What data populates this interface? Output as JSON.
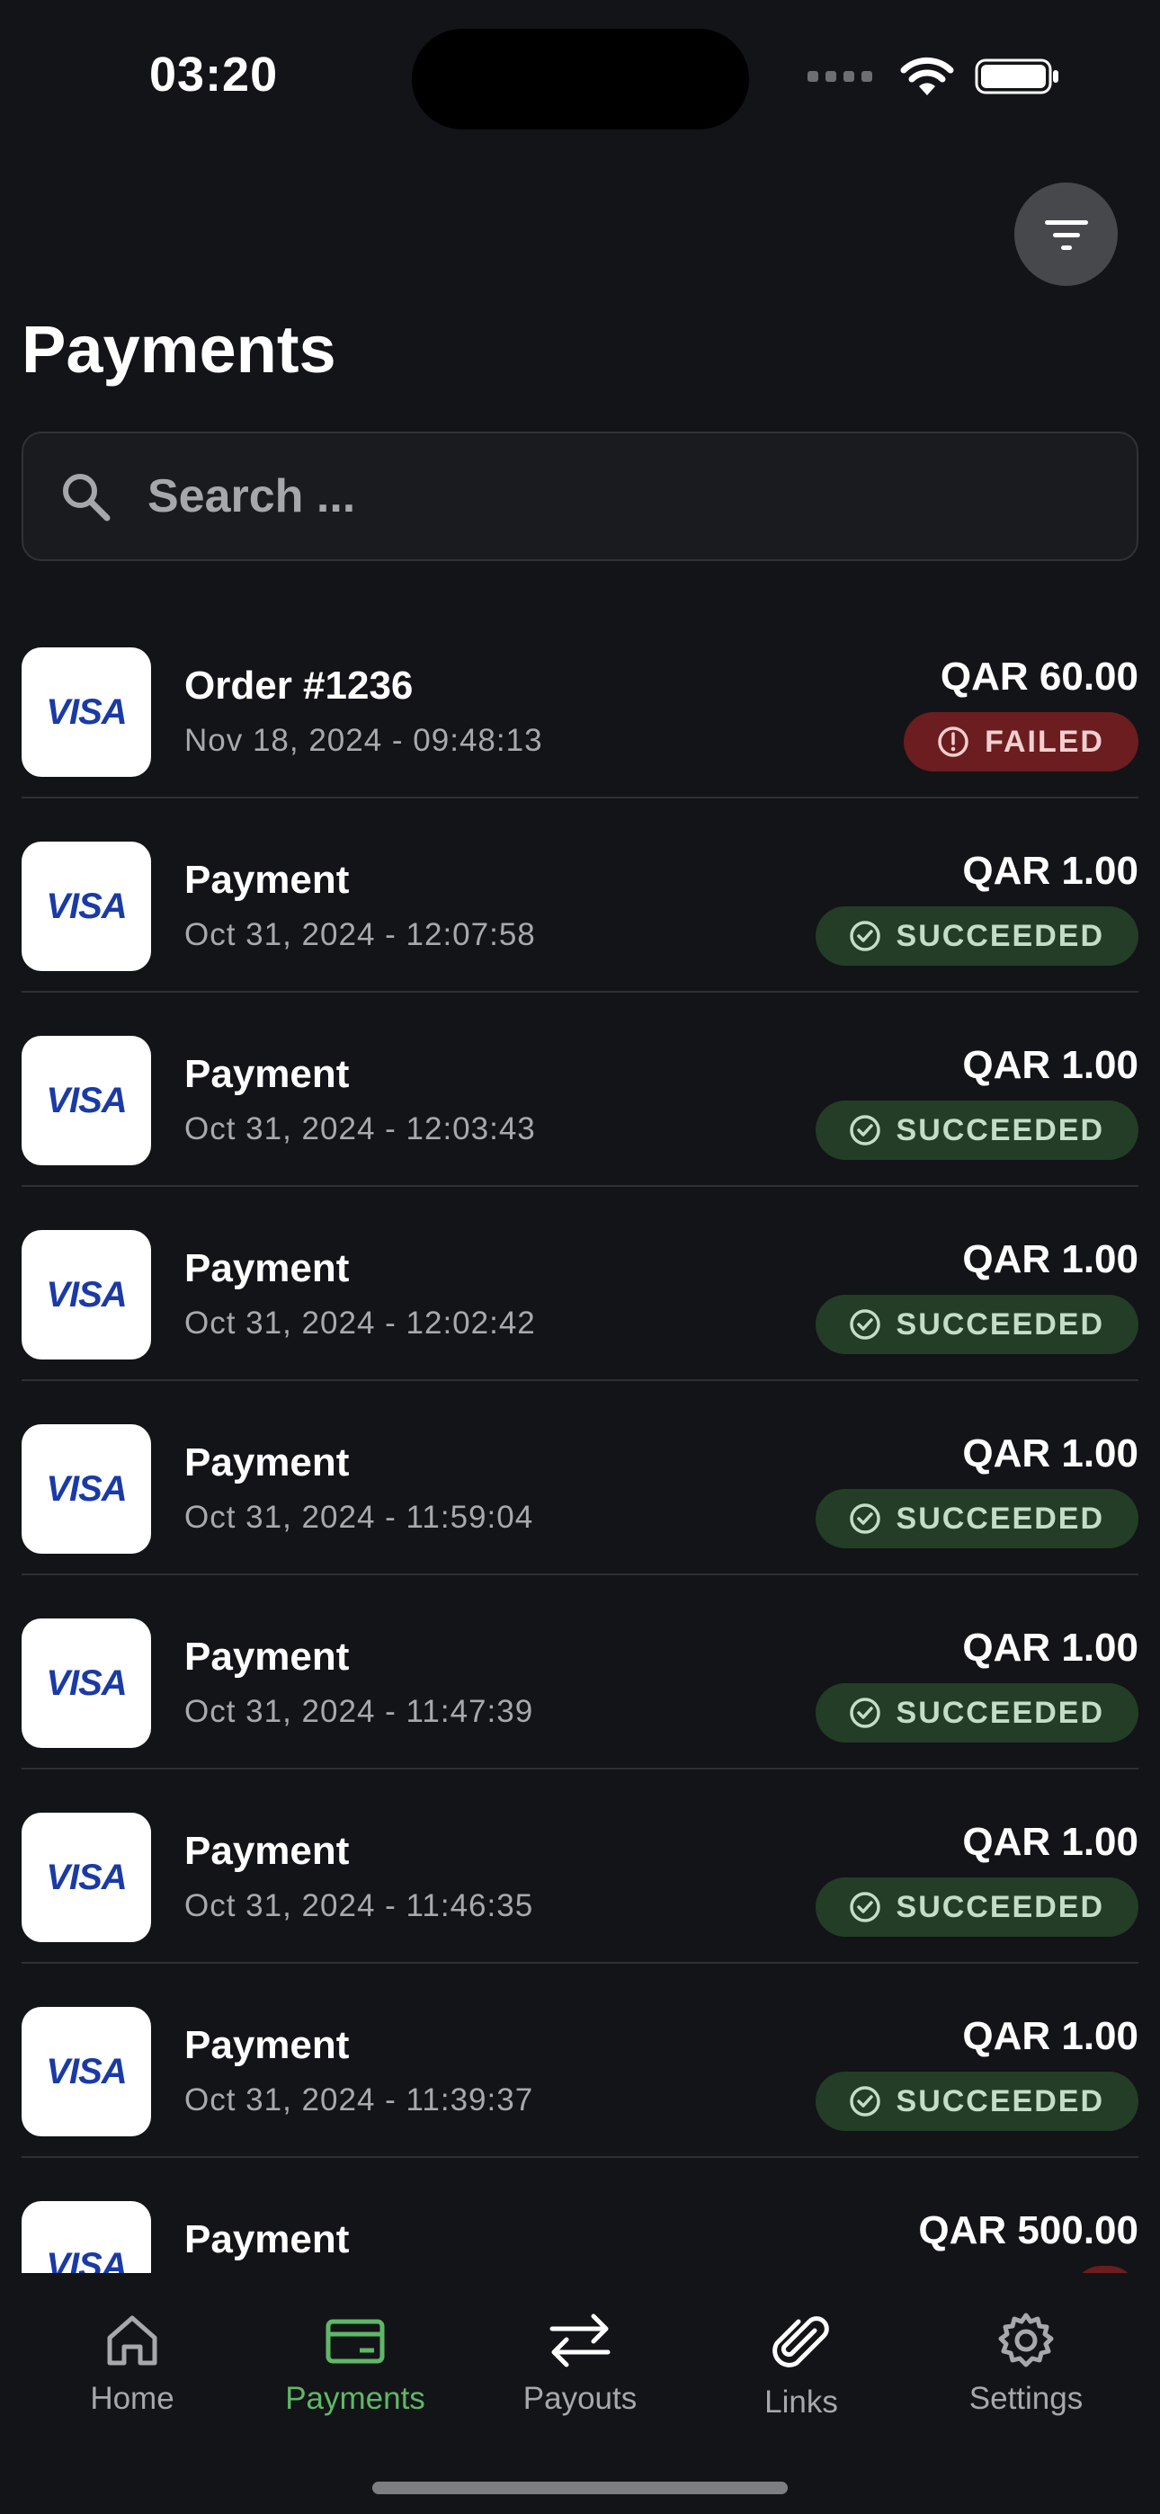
{
  "status_bar": {
    "time": "03:20"
  },
  "header": {
    "title": "Payments",
    "filter_icon": "filter-icon"
  },
  "search": {
    "placeholder": "Search ..."
  },
  "payments": [
    {
      "title": "Order #1236",
      "date": "Nov 18, 2024 - 09:48:13",
      "amount": "QAR 60.00",
      "status": "FAILED",
      "status_kind": "failed",
      "card": "VISA"
    },
    {
      "title": "Payment",
      "date": "Oct 31, 2024 - 12:07:58",
      "amount": "QAR 1.00",
      "status": "SUCCEEDED",
      "status_kind": "succeeded",
      "card": "VISA"
    },
    {
      "title": "Payment",
      "date": "Oct 31, 2024 - 12:03:43",
      "amount": "QAR 1.00",
      "status": "SUCCEEDED",
      "status_kind": "succeeded",
      "card": "VISA"
    },
    {
      "title": "Payment",
      "date": "Oct 31, 2024 - 12:02:42",
      "amount": "QAR 1.00",
      "status": "SUCCEEDED",
      "status_kind": "succeeded",
      "card": "VISA"
    },
    {
      "title": "Payment",
      "date": "Oct 31, 2024 - 11:59:04",
      "amount": "QAR 1.00",
      "status": "SUCCEEDED",
      "status_kind": "succeeded",
      "card": "VISA"
    },
    {
      "title": "Payment",
      "date": "Oct 31, 2024 - 11:47:39",
      "amount": "QAR 1.00",
      "status": "SUCCEEDED",
      "status_kind": "succeeded",
      "card": "VISA"
    },
    {
      "title": "Payment",
      "date": "Oct 31, 2024 - 11:46:35",
      "amount": "QAR 1.00",
      "status": "SUCCEEDED",
      "status_kind": "succeeded",
      "card": "VISA"
    },
    {
      "title": "Payment",
      "date": "Oct 31, 2024 - 11:39:37",
      "amount": "QAR 1.00",
      "status": "SUCCEEDED",
      "status_kind": "succeeded",
      "card": "VISA"
    },
    {
      "title": "Payment",
      "date": "",
      "amount": "QAR 500.00",
      "status": "",
      "status_kind": "failed",
      "card": "VISA"
    }
  ],
  "tabbar": {
    "items": [
      {
        "label": "Home",
        "icon": "home-icon",
        "active": false
      },
      {
        "label": "Payments",
        "icon": "card-icon",
        "active": true
      },
      {
        "label": "Payouts",
        "icon": "transfer-arrows-icon",
        "active": false
      },
      {
        "label": "Links",
        "icon": "paperclip-icon",
        "active": false
      },
      {
        "label": "Settings",
        "icon": "gear-icon",
        "active": false
      }
    ]
  },
  "colors": {
    "background": "#131417",
    "accent": "#5fb866",
    "success_badge": "#233d27",
    "failed_badge": "#6b1d20"
  }
}
